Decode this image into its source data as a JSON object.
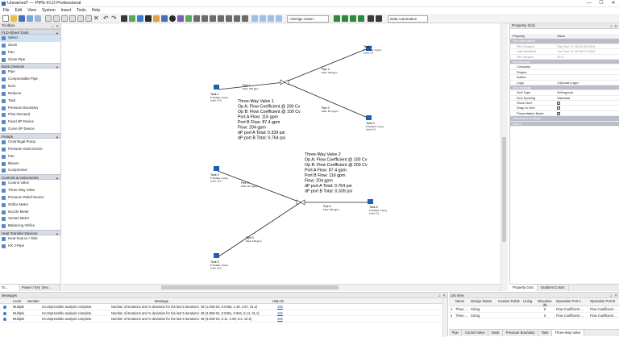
{
  "window": {
    "title": "Unnamed* — PIPE-FLO Professional",
    "min": "—",
    "max": "☐",
    "close": "✕"
  },
  "menu": [
    "File",
    "Edit",
    "View",
    "System",
    "Insert",
    "Tools",
    "Help"
  ],
  "toolbar": {
    "design_case": "<Design Case>",
    "data_automation": "Data Automation"
  },
  "toolbox": {
    "title": "Toolbox",
    "categories": [
      {
        "label": "FLO-Sheet Tools",
        "items": [
          "Select",
          "Zoom",
          "Pan",
          "Close Pipe"
        ]
      },
      {
        "label": "Basic Devices",
        "items": [
          "Pipe",
          "Compressible Pipe",
          "Duct",
          "Reducer",
          "Tank",
          "Pressure Boundary",
          "Flow Demand",
          "Fixed dP Device",
          "Curve dP Device"
        ]
      },
      {
        "label": "Pumps",
        "items": [
          "Centrifugal Pump",
          "Pressure Gain Device",
          "Fan",
          "Blower",
          "Compressor"
        ]
      },
      {
        "label": "Controls & Instruments",
        "items": [
          "Control Valve",
          "Three-Way Valve",
          "Pressure Relief Device",
          "Orifice Meter",
          "Nozzle Meter",
          "Venturi Meter",
          "Balancing Orifice"
        ]
      },
      {
        "label": "Heat Transfer Devices",
        "items": [
          "Heat Source / Sink",
          "HX 2-Pipe"
        ]
      }
    ],
    "tabs": [
      "To...",
      "Power / Ene...",
      "Dev..."
    ]
  },
  "canvas": {
    "tanks": [
      {
        "name": "Tank 1",
        "l1": "P Surface: 0 psi g",
        "l2": "Level: 10 ft"
      },
      {
        "name": "Tank 2",
        "l1": "P Surface: 0 psi g",
        "l2": "Level: 0 ft"
      },
      {
        "name": "Tank 3",
        "l1": "P Surface: 0 psi g",
        "l2": "Level: 0 ft"
      },
      {
        "name": "Tank 4",
        "l1": "P Surface: 0 psi g",
        "l2": "Level: 10 ft"
      },
      {
        "name": "Tank 5",
        "l1": "P Surface: 0 psi g",
        "l2": "Level: 10 ft"
      },
      {
        "name": "Tank 6",
        "l1": "P Surface: 0 psi g",
        "l2": "Level: 0 ft"
      }
    ],
    "pipes": [
      {
        "name": "Pipe 1",
        "flow": "Flow: 204 gpm"
      },
      {
        "name": "Pipe 2",
        "flow": "Flow: 116 gpm"
      },
      {
        "name": "Pipe 3",
        "flow": "Flow: 87.4 gpm"
      },
      {
        "name": "Pipe 4",
        "flow": "Flow: 87.4 gpm"
      },
      {
        "name": "Pipe 5",
        "flow": "Flow: 116 gpm"
      },
      {
        "name": "Pipe 6",
        "flow": "Flow: 204 gpm"
      }
    ],
    "valve1": {
      "title": "Three-Way Valve 1",
      "lines": [
        "Op A:  Flow Coefficient @ 200 Cv",
        "Op B:  Flow Coefficient @ 100 Cv",
        "Port A Flow: 116 gpm",
        "Port B Flow: 87.4 gpm",
        "Flow: 204 gpm",
        "dP port A Total: 0.339 psi",
        "dP port B Total: 0.764 psi"
      ]
    },
    "valve2": {
      "title": "Three-Way Valve 2",
      "lines": [
        "Op A:  Flow Coefficient @ 100 Cv",
        "Op B:  Flow Coefficient @ 200 Cv",
        "Port A Flow: 87.4 gpm",
        "Port B Flow: 116 gpm",
        "Flow: 204 gpm",
        "dP port A Total: 0.764 psi",
        "dP port B Total: 0.339 psi"
      ]
    }
  },
  "property_grid": {
    "title": "Property Grid",
    "header": {
      "col1": "Property",
      "col2": "Value"
    },
    "rows": [
      {
        "type": "cat",
        "k": "File Information"
      },
      {
        "type": "dim",
        "k": "File Created",
        "v": "Tue Dec 17 10:02:29 2024"
      },
      {
        "type": "dim",
        "k": "Last Modified",
        "v": "Tue Dec 17 10:08:17 2024"
      },
      {
        "type": "dim",
        "k": "File Version",
        "v": "20.0"
      },
      {
        "type": "cat",
        "k": "Identification"
      },
      {
        "type": "row",
        "k": "Company",
        "v": ""
      },
      {
        "type": "row",
        "k": "Project",
        "v": ""
      },
      {
        "type": "row",
        "k": "Author",
        "v": ""
      },
      {
        "type": "row",
        "k": "Logo",
        "v": "<Upload Logo>"
      },
      {
        "type": "cat",
        "k": "Grid Settings"
      },
      {
        "type": "row",
        "k": "Grid Type",
        "v": "Orthogonal"
      },
      {
        "type": "row",
        "k": "Grid Spacing",
        "v": "Standard"
      },
      {
        "type": "chk",
        "k": "Show Grid"
      },
      {
        "type": "chk",
        "k": "Snap to Grid"
      },
      {
        "type": "chk",
        "k": "Presentation Mode"
      },
      {
        "type": "cat",
        "k": "Calculation Settings"
      },
      {
        "type": "cat",
        "k": "Notes"
      }
    ],
    "tabs": [
      "Property Grid",
      "Gradient Colors"
    ]
  },
  "messages": {
    "title": "Messages",
    "columns": [
      "Level",
      "Number",
      "Message",
      "Help ID"
    ],
    "rows": [
      {
        "level": "Multiple",
        "number": "Incompressible analysis complete.",
        "message": "Number of iterations and % deviation for the last 5 iterations: 48 (1.03E-03, 0.0455, 1.49, 4.67, 31.2)",
        "help": "196"
      },
      {
        "level": "Multiple",
        "number": "Incompressible analysis complete.",
        "message": "Number of iterations and % deviation for the last 5 iterations: 48 (3.35E-04, 0.0261, 0.946, 5.14, 31.1)",
        "help": "196"
      },
      {
        "level": "Multiple",
        "number": "Incompressible analysis complete.",
        "message": "Number of iterations and % deviation for the last 5 iterations: 48 (3.30E-03, 0.11, 2.09, 6.2, 10.6)",
        "help": "196"
      }
    ]
  },
  "list_view": {
    "title": "List View",
    "columns": [
      "Name",
      "Design Status",
      "Custom Fields",
      "Lining",
      "Elevation (ft)",
      "Operation Port A",
      "Operation Port B"
    ],
    "rows": [
      {
        "idx": "1",
        "name": "Three ...",
        "status": "Sizing",
        "lining": "",
        "elev": "0",
        "opA": "Flow Coefficient ...",
        "opB": "Flow Coefficient ..."
      },
      {
        "idx": "2",
        "name": "Three ...",
        "status": "Sizing",
        "lining": "",
        "elev": "0",
        "opA": "Flow Coefficient ...",
        "opB": "Flow Coefficient ..."
      }
    ],
    "tabs": [
      "Pipe",
      "Control Valve",
      "Node",
      "Pressure Boundary",
      "Tank",
      "Three-Way Valve"
    ]
  },
  "colors": {
    "tank": "#1f5fb0",
    "pipe": "#222222",
    "selected": "#cfe3f7"
  }
}
